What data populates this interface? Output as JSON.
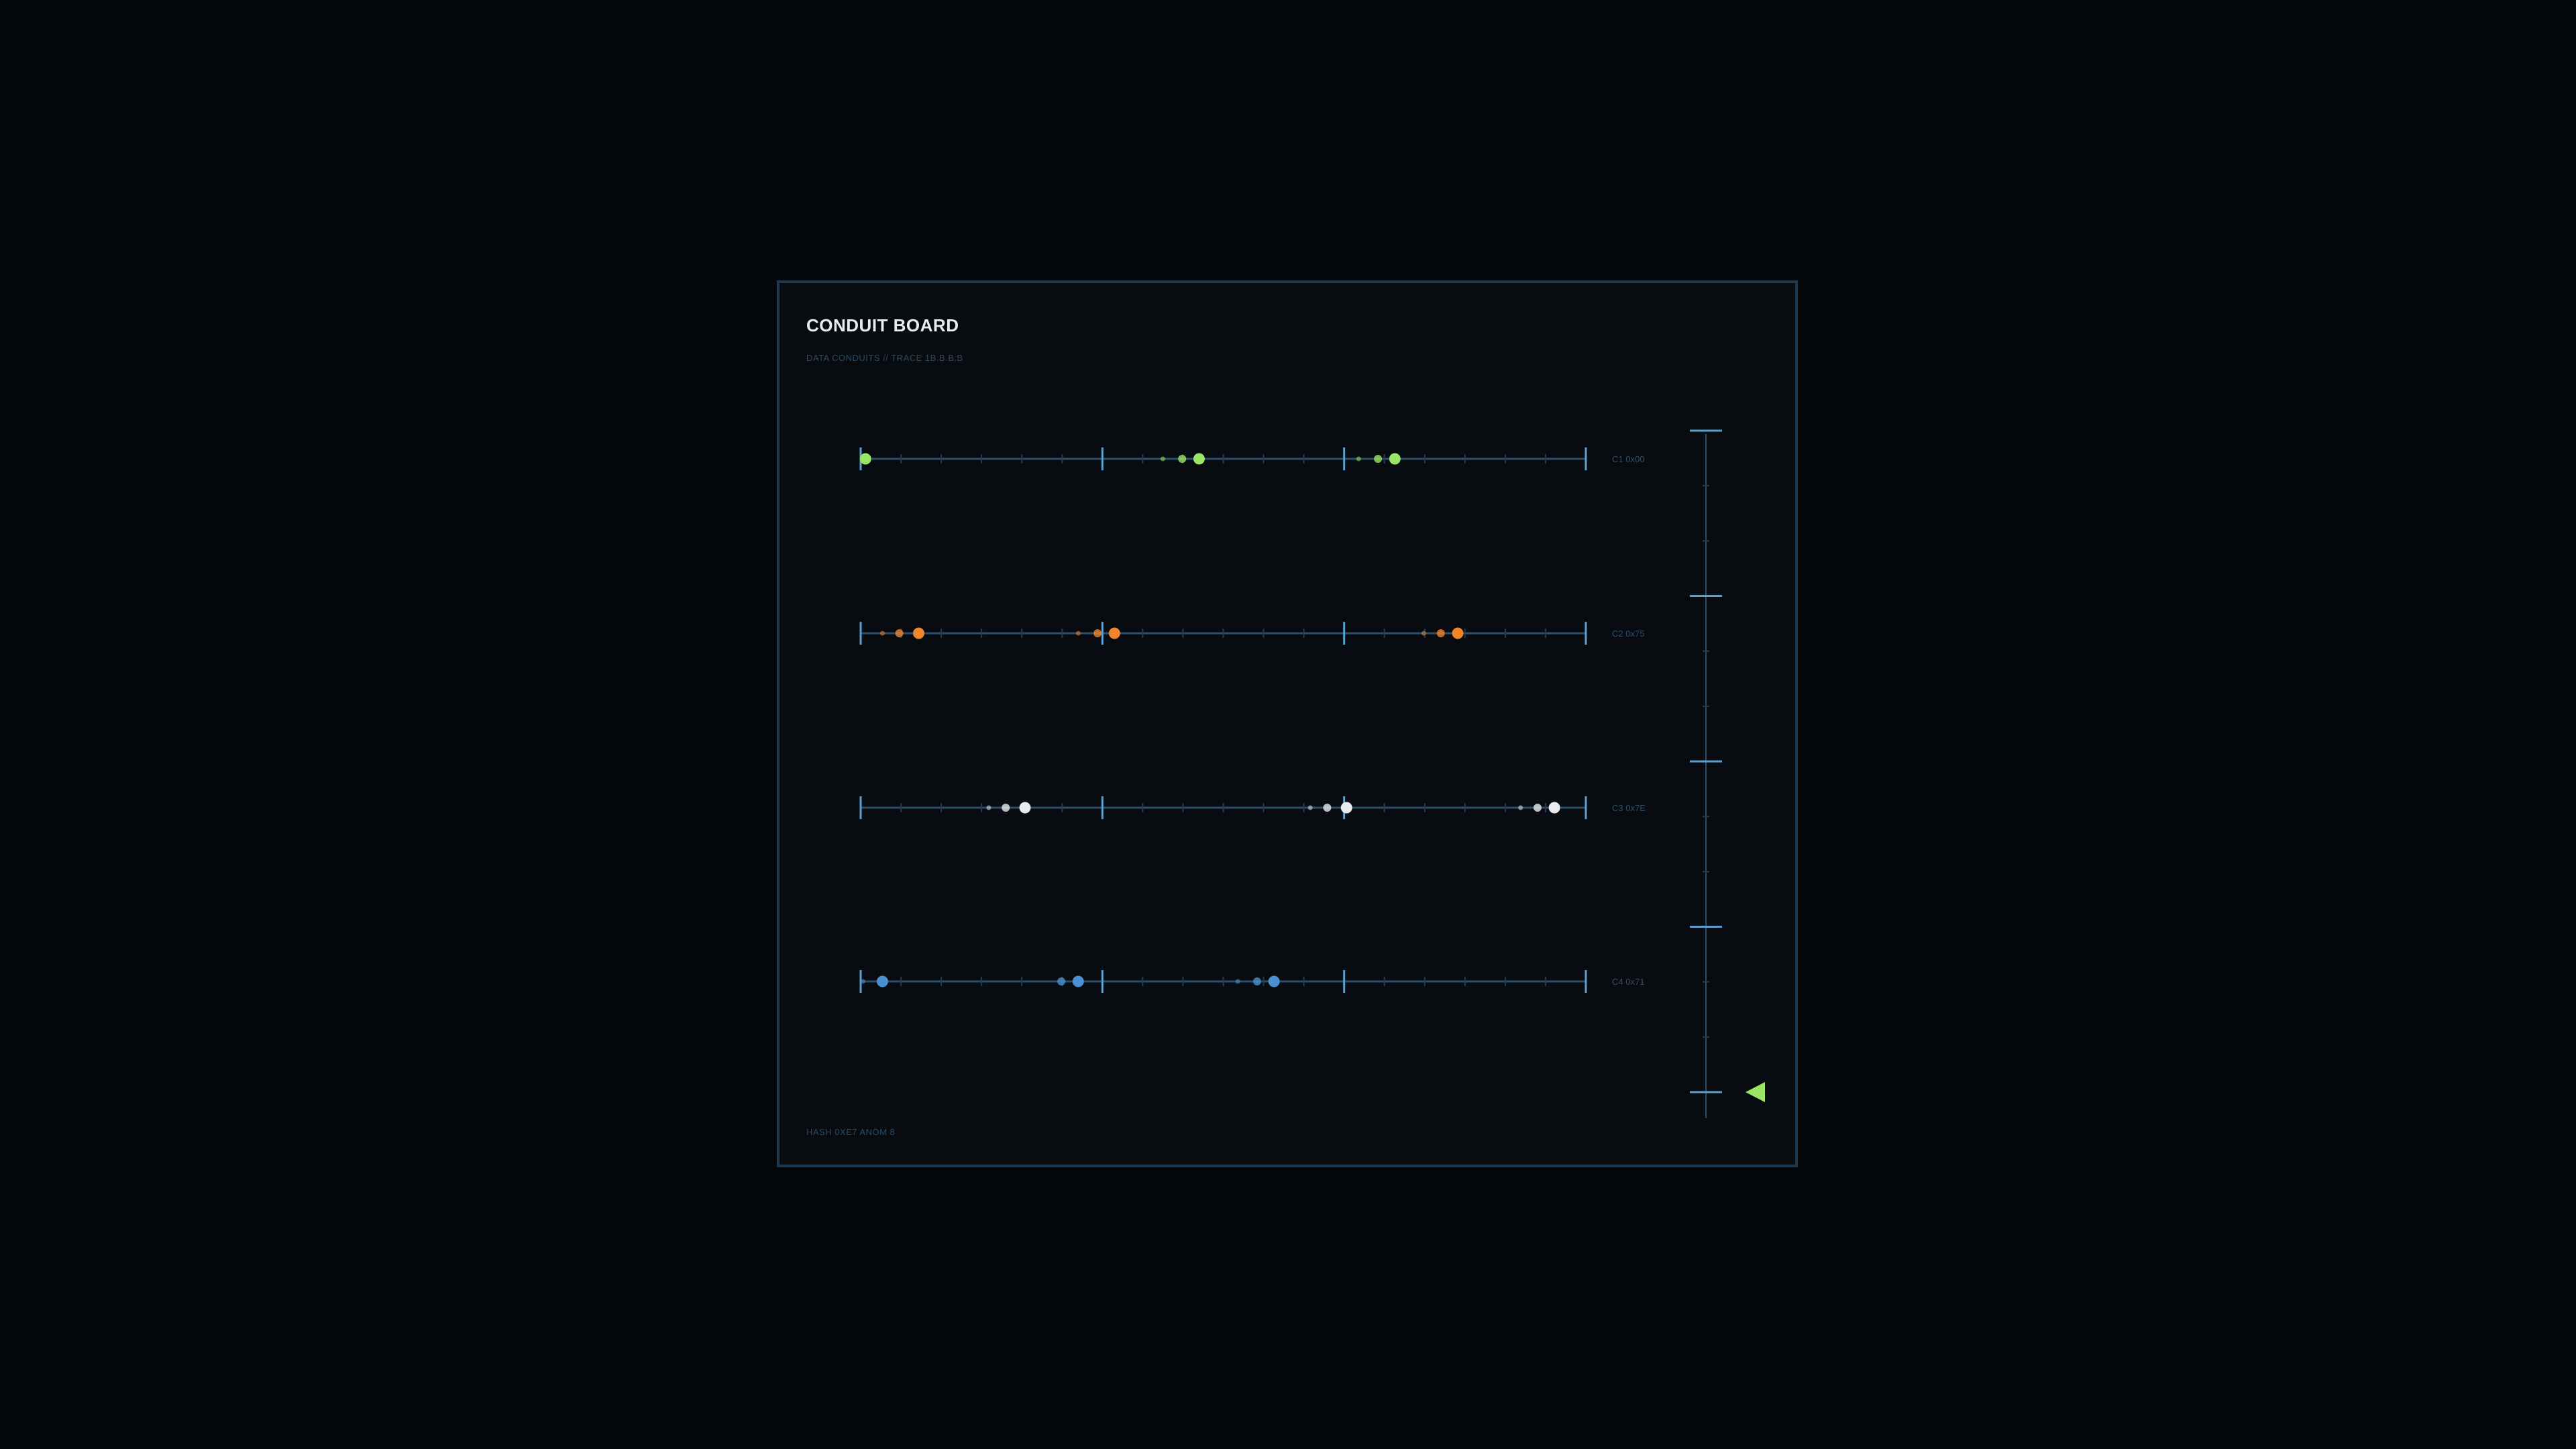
{
  "board": {
    "title": "CONDUIT BOARD",
    "subtitle": "DATA CONDUITS // TRACE 1B.B.B.B",
    "footer": "HASH 0XE7 ANOM 8"
  },
  "colors": {
    "background": "#05080b",
    "panel": "#080c10",
    "border": "#1d3a52",
    "conduit_line": "#2a4f6c",
    "major_tick": "#5b9fd0",
    "minor_tick": "#223c52",
    "pointer": "#9be564"
  },
  "icons": {
    "pointer": "triangle-pointer-icon"
  },
  "chart_data": {
    "type": "scatter",
    "x_range": [
      0,
      3
    ],
    "major_ticks_per_conduit": 4,
    "minor_ticks_per_segment": 6,
    "side_scale": {
      "major_ticks": 5,
      "minor_ticks_between": 2,
      "pointer_position": 1.0
    },
    "series": [
      {
        "name": "C1 0x00",
        "color": "#9be564",
        "pulses": [
          {
            "x": 0.02,
            "size": 3
          },
          {
            "x": 1.25,
            "size": 1
          },
          {
            "x": 1.33,
            "size": 2
          },
          {
            "x": 1.4,
            "size": 3
          },
          {
            "x": 2.06,
            "size": 1
          },
          {
            "x": 2.14,
            "size": 2
          },
          {
            "x": 2.21,
            "size": 3
          }
        ]
      },
      {
        "name": "C2 0x75",
        "color": "#f0852a",
        "pulses": [
          {
            "x": 0.09,
            "size": 1
          },
          {
            "x": 0.16,
            "size": 2
          },
          {
            "x": 0.24,
            "size": 3
          },
          {
            "x": 0.9,
            "size": 1
          },
          {
            "x": 0.98,
            "size": 2
          },
          {
            "x": 1.05,
            "size": 3
          },
          {
            "x": 2.33,
            "size": 1
          },
          {
            "x": 2.4,
            "size": 2
          },
          {
            "x": 2.47,
            "size": 3
          }
        ]
      },
      {
        "name": "C3 0x7E",
        "color": "#e8ecef",
        "pulses": [
          {
            "x": 0.53,
            "size": 1
          },
          {
            "x": 0.6,
            "size": 2
          },
          {
            "x": 0.68,
            "size": 3
          },
          {
            "x": 1.86,
            "size": 1
          },
          {
            "x": 1.93,
            "size": 2
          },
          {
            "x": 2.01,
            "size": 3
          },
          {
            "x": 2.73,
            "size": 1
          },
          {
            "x": 2.8,
            "size": 2
          },
          {
            "x": 2.87,
            "size": 3
          }
        ]
      },
      {
        "name": "C4 0x71",
        "color": "#4a8fd0",
        "pulses": [
          {
            "x": 0.01,
            "size": 1
          },
          {
            "x": 0.09,
            "size": 3
          },
          {
            "x": 0.83,
            "size": 2
          },
          {
            "x": 0.9,
            "size": 3
          },
          {
            "x": 1.56,
            "size": 1
          },
          {
            "x": 1.64,
            "size": 2
          },
          {
            "x": 1.71,
            "size": 3
          }
        ]
      }
    ]
  }
}
